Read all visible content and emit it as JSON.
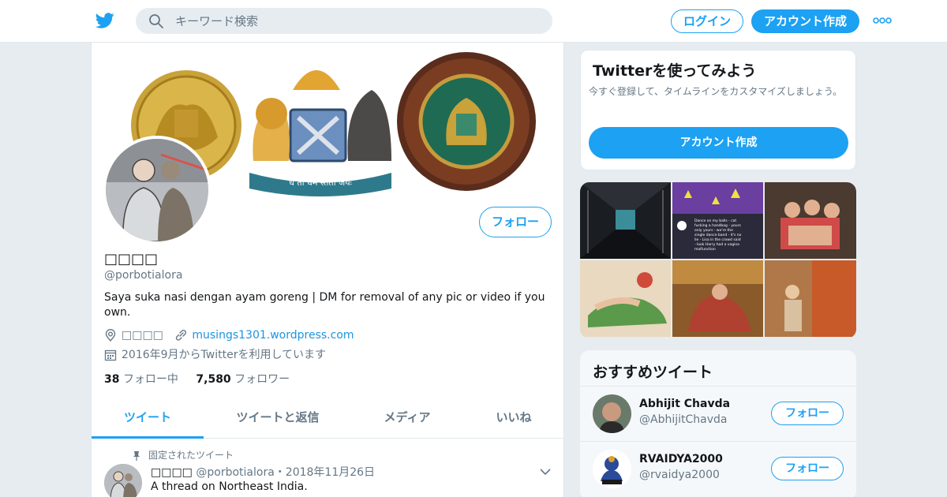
{
  "colors": {
    "accent": "#1da1f2",
    "link": "#1b95e0",
    "muted": "#657786",
    "text": "#14171a",
    "background": "#e6ecf0"
  },
  "header": {
    "logo_icon": "twitter-bird-icon",
    "search": {
      "placeholder": "キーワード検索",
      "icon": "search-icon"
    },
    "login_label": "ログイン",
    "signup_label": "アカウント作成",
    "more_icon": "more-dots-icon"
  },
  "profile": {
    "name": "□□□□",
    "handle": "@porbotialora",
    "bio": "Saya suka nasi dengan ayam goreng | DM for removal of any pic or video if you own.",
    "location": "□□□□",
    "website": "musings1301.wordpress.com",
    "joined": "2016年9月からTwitterを利用しています",
    "following_count": "38",
    "following_label": "フォロー中",
    "followers_count": "7,580",
    "followers_label": "フォロワー",
    "follow_label": "フォロー",
    "banner_motto": "ध तो धर्म स्ततो जयः"
  },
  "tabs": [
    {
      "label": "ツイート",
      "active": true
    },
    {
      "label": "ツイートと返信",
      "active": false
    },
    {
      "label": "メディア",
      "active": false
    },
    {
      "label": "いいね",
      "active": false
    }
  ],
  "pinned_tweet": {
    "pinned_label": "固定されたツイート",
    "author_name": "□□□□",
    "author_handle": "@porbotialora",
    "date": "・2018年11月26日",
    "text": "A thread on Northeast India."
  },
  "signup_card": {
    "title": "Twitterを使ってみよう",
    "description": "今すぐ登録して、タイムラインをカスタマイズしましょう。",
    "button_label": "アカウント作成"
  },
  "media_grid": {
    "caption_lines": [
      "Dance on my balls - cat",
      "fucking a handbag - yours",
      "only yours - we're the",
      "single dance band - it's no",
      "lie - Lisa in the crowd said",
      "- look Harry had a vagina",
      "malfunction"
    ]
  },
  "recommended": {
    "title": "おすすめツイート",
    "users": [
      {
        "name": "Abhijit Chavda",
        "handle": "@AbhijitChavda",
        "follow_label": "フォロー"
      },
      {
        "name": "RVAIDYA2000",
        "handle": "@rvaidya2000",
        "follow_label": "フォロー"
      }
    ]
  }
}
